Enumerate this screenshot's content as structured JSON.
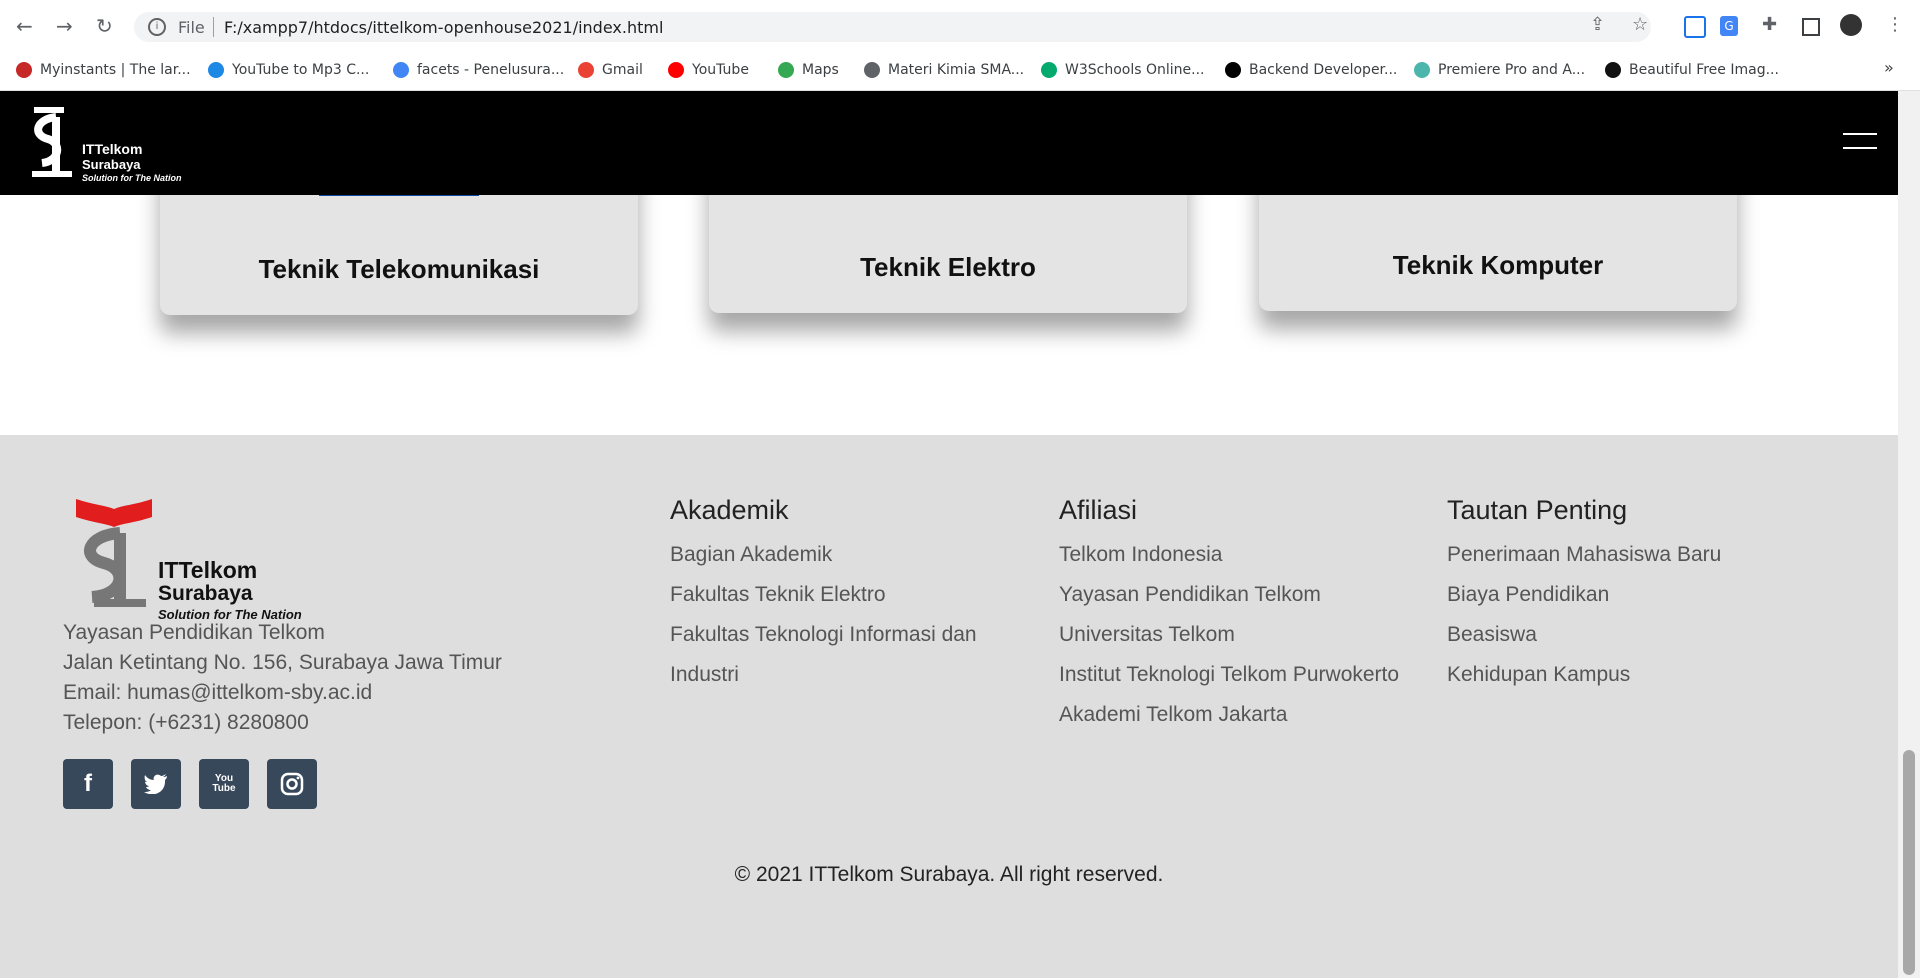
{
  "browser": {
    "file_label": "File",
    "url": "F:/xampp7/htdocs/ittelkom-openhouse2021/index.html",
    "bookmarks": [
      {
        "label": "Myinstants | The lar...",
        "icon": "myinstants-icon",
        "color": "#c62828"
      },
      {
        "label": "YouTube to Mp3 C...",
        "icon": "download-cloud-icon",
        "color": "#1e88e5"
      },
      {
        "label": "facets - Penelusura...",
        "icon": "google-icon",
        "color": "#4285f4"
      },
      {
        "label": "Gmail",
        "icon": "gmail-icon",
        "color": "#ea4335"
      },
      {
        "label": "YouTube",
        "icon": "youtube-icon",
        "color": "#ff0000"
      },
      {
        "label": "Maps",
        "icon": "maps-icon",
        "color": "#34a853"
      },
      {
        "label": "Materi Kimia SMA...",
        "icon": "globe-icon",
        "color": "#5f6368"
      },
      {
        "label": "W3Schools Online...",
        "icon": "w3schools-icon",
        "color": "#04aa6d"
      },
      {
        "label": "Backend Developer...",
        "icon": "roadmap-icon",
        "color": "#000000"
      },
      {
        "label": "Premiere Pro and A...",
        "icon": "motion-icon",
        "color": "#4db6ac"
      },
      {
        "label": "Beautiful Free Imag...",
        "icon": "unsplash-icon",
        "color": "#111111"
      }
    ]
  },
  "navbar": {
    "logo_line1": "ITTelkom",
    "logo_line2": "Surabaya",
    "logo_tagline": "Solution for The Nation"
  },
  "cards": [
    {
      "title": "Teknik Telekomunikasi"
    },
    {
      "title": "Teknik Elektro"
    },
    {
      "title": "Teknik Komputer"
    }
  ],
  "footer": {
    "logo_line1": "ITTelkom",
    "logo_line2": "Surabaya",
    "logo_tagline": "Solution for The Nation",
    "address_lines": [
      "Yayasan Pendidikan Telkom",
      "Jalan Ketintang No. 156, Surabaya Jawa Timur",
      "Email: humas@ittelkom-sby.ac.id",
      "Telepon: (+6231) 8280800"
    ],
    "social": [
      {
        "icon": "facebook-icon",
        "glyph": "f"
      },
      {
        "icon": "twitter-icon",
        "glyph": "🐦"
      },
      {
        "icon": "youtube-icon",
        "glyph": "You Tube"
      },
      {
        "icon": "instagram-icon",
        "glyph": ""
      }
    ],
    "columns": [
      {
        "title": "Akademik",
        "links": [
          "Bagian Akademik",
          "Fakultas Teknik Elektro",
          "Fakultas Teknologi Informasi dan",
          "Industri"
        ]
      },
      {
        "title": "Afiliasi",
        "links": [
          "Telkom Indonesia",
          "Yayasan Pendidikan Telkom",
          "Universitas Telkom",
          "Institut Teknologi Telkom Purwokerto",
          "Akademi Telkom Jakarta"
        ]
      },
      {
        "title": "Tautan Penting",
        "links": [
          "Penerimaan Mahasiswa Baru",
          "Biaya Pendidikan",
          "Beasiswa",
          "Kehidupan Kampus"
        ]
      }
    ],
    "copyright": "© 2021 ITTelkom Surabaya. All right reserved."
  }
}
